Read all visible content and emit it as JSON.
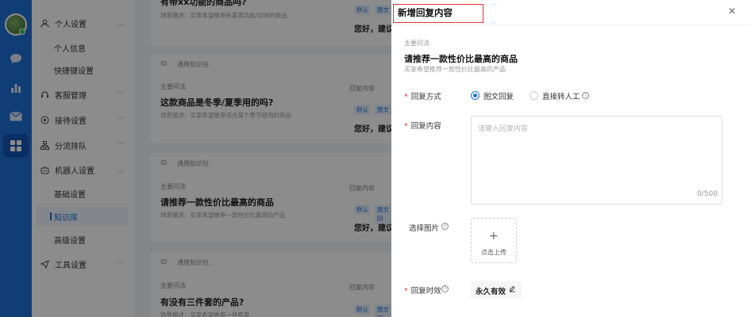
{
  "menu": {
    "items": [
      {
        "label": "个人设置",
        "icon": "user-icon"
      },
      {
        "label": "客服管理",
        "icon": "headset-icon"
      },
      {
        "label": "接待设置",
        "icon": "target-icon"
      },
      {
        "label": "分流排队",
        "icon": "flow-icon"
      },
      {
        "label": "机器人设置",
        "icon": "robot-icon"
      },
      {
        "label": "工具设置",
        "icon": "send-icon"
      }
    ],
    "sub_personal": [
      "个人信息",
      "快捷键设置"
    ],
    "sub_robot": [
      "基础设置",
      "知识库",
      "高级设置"
    ]
  },
  "list": {
    "id_label": "ID",
    "group_label": "通用知识包",
    "question_label": "主要问法",
    "reply_label": "回复内容",
    "tag_default": "默认",
    "tag_image": "图文",
    "tag_image_full": "图文回",
    "reply_text": "您好，建议",
    "top_title": "有带xx功能的商品吗?",
    "top_scene": "场景描述：买家希望推荐有某类功能/功效的商品",
    "cards": [
      {
        "title": "这款商品是冬季/夏季用的吗?",
        "scene": "场景描述：买家希望推荐适合某个季节使用的商品"
      },
      {
        "title": "请推荐一款性价比最高的商品",
        "scene": "场景描述：买家希望推荐一款性价比最高的产品"
      },
      {
        "title": "有没有三件套的产品?",
        "scene": "场景描述：买家希望推荐一些套装"
      }
    ]
  },
  "drawer": {
    "title": "新增回复内容",
    "section_label": "主要问法",
    "question": "请推荐一款性价比最高的商品",
    "scene": "买家希望推荐一款性价比最高的产品",
    "reply_mode_label": "回复方式",
    "reply_mode_options": [
      "图文回复",
      "直接转人工"
    ],
    "reply_content_label": "回复内容",
    "reply_placeholder": "请输入回复内容",
    "char_count": "0/500",
    "image_label": "选择图片",
    "upload_label": "点击上传",
    "validity_label": "回复时效",
    "validity_value": "永久有效"
  },
  "colors": {
    "accent": "#1f6fd8",
    "required": "#e0303a",
    "highlight_box": "#e0303a"
  }
}
